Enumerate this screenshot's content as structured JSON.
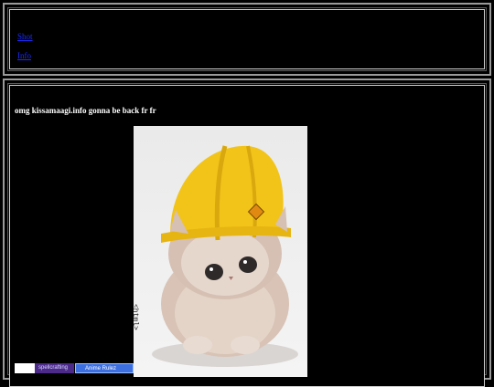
{
  "nav": {
    "links": [
      "Shot",
      "Info"
    ]
  },
  "main": {
    "message": "omg kissamaagi.info gonna be back fr fr",
    "photo_caption": "<html>"
  },
  "badges": [
    "spellcrafting",
    "Anime Rulez"
  ],
  "colors": {
    "background": "#000000",
    "link": "#1a2cff",
    "frame": "#9a9a9a",
    "helmet": "#f2c419"
  }
}
